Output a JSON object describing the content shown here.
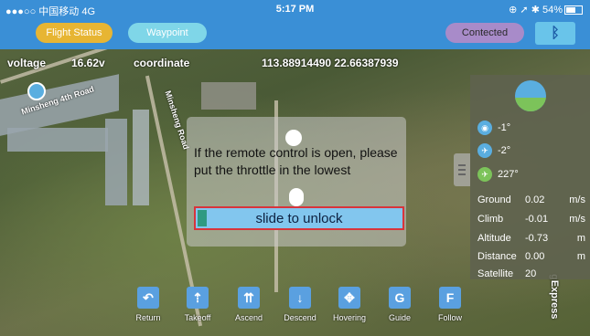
{
  "status_bar": {
    "carrier": "●●●○○ 中国移动 4G",
    "time": "5:17 PM",
    "right": "⊕ ➚ ✱ 54%"
  },
  "top_nav": {
    "flight_status": "Flight Status",
    "waypoint": "Waypoint",
    "connected": "Contected",
    "bluetooth_icon": "bluetooth-icon"
  },
  "telemetry": {
    "voltage_label": "voltage",
    "voltage_value": "16.62v",
    "coordinate_label": "coordinate",
    "coordinate_value": "113.88914490 22.66387939"
  },
  "map": {
    "road_1": "Minsheng 4th Road",
    "road_2": "Minsheng Road",
    "watermark": "gExpress"
  },
  "dialog": {
    "message": "If the remote control is open, please put the throttle in the lowest",
    "slider_label": "slide to unlock"
  },
  "right_panel": {
    "pitch": "-1°",
    "roll": "-2°",
    "heading": "227°",
    "stats": [
      {
        "key": "Ground",
        "value": "0.02",
        "unit": "m/s"
      },
      {
        "key": "Climb",
        "value": "-0.01",
        "unit": "m/s"
      },
      {
        "key": "Altitude",
        "value": "-0.73",
        "unit": "m"
      },
      {
        "key": "Distance",
        "value": "0.00",
        "unit": "m"
      },
      {
        "key": "Satellite",
        "value": "20",
        "unit": ""
      }
    ]
  },
  "toolbar": [
    {
      "label": "Return",
      "icon": "↶"
    },
    {
      "label": "Takeoff",
      "icon": "⇡"
    },
    {
      "label": "Ascend",
      "icon": "⇈"
    },
    {
      "label": "Descend",
      "icon": "↓"
    },
    {
      "label": "Hovering",
      "icon": "✥"
    },
    {
      "label": "Guide",
      "icon": "G"
    },
    {
      "label": "Follow",
      "icon": "F"
    }
  ],
  "colors": {
    "bar_blue": "#3a8fd6",
    "flight_status": "#e7b533",
    "waypoint": "#7fd6e8",
    "connected": "#a88bc9",
    "slider_border": "#d8343c"
  }
}
